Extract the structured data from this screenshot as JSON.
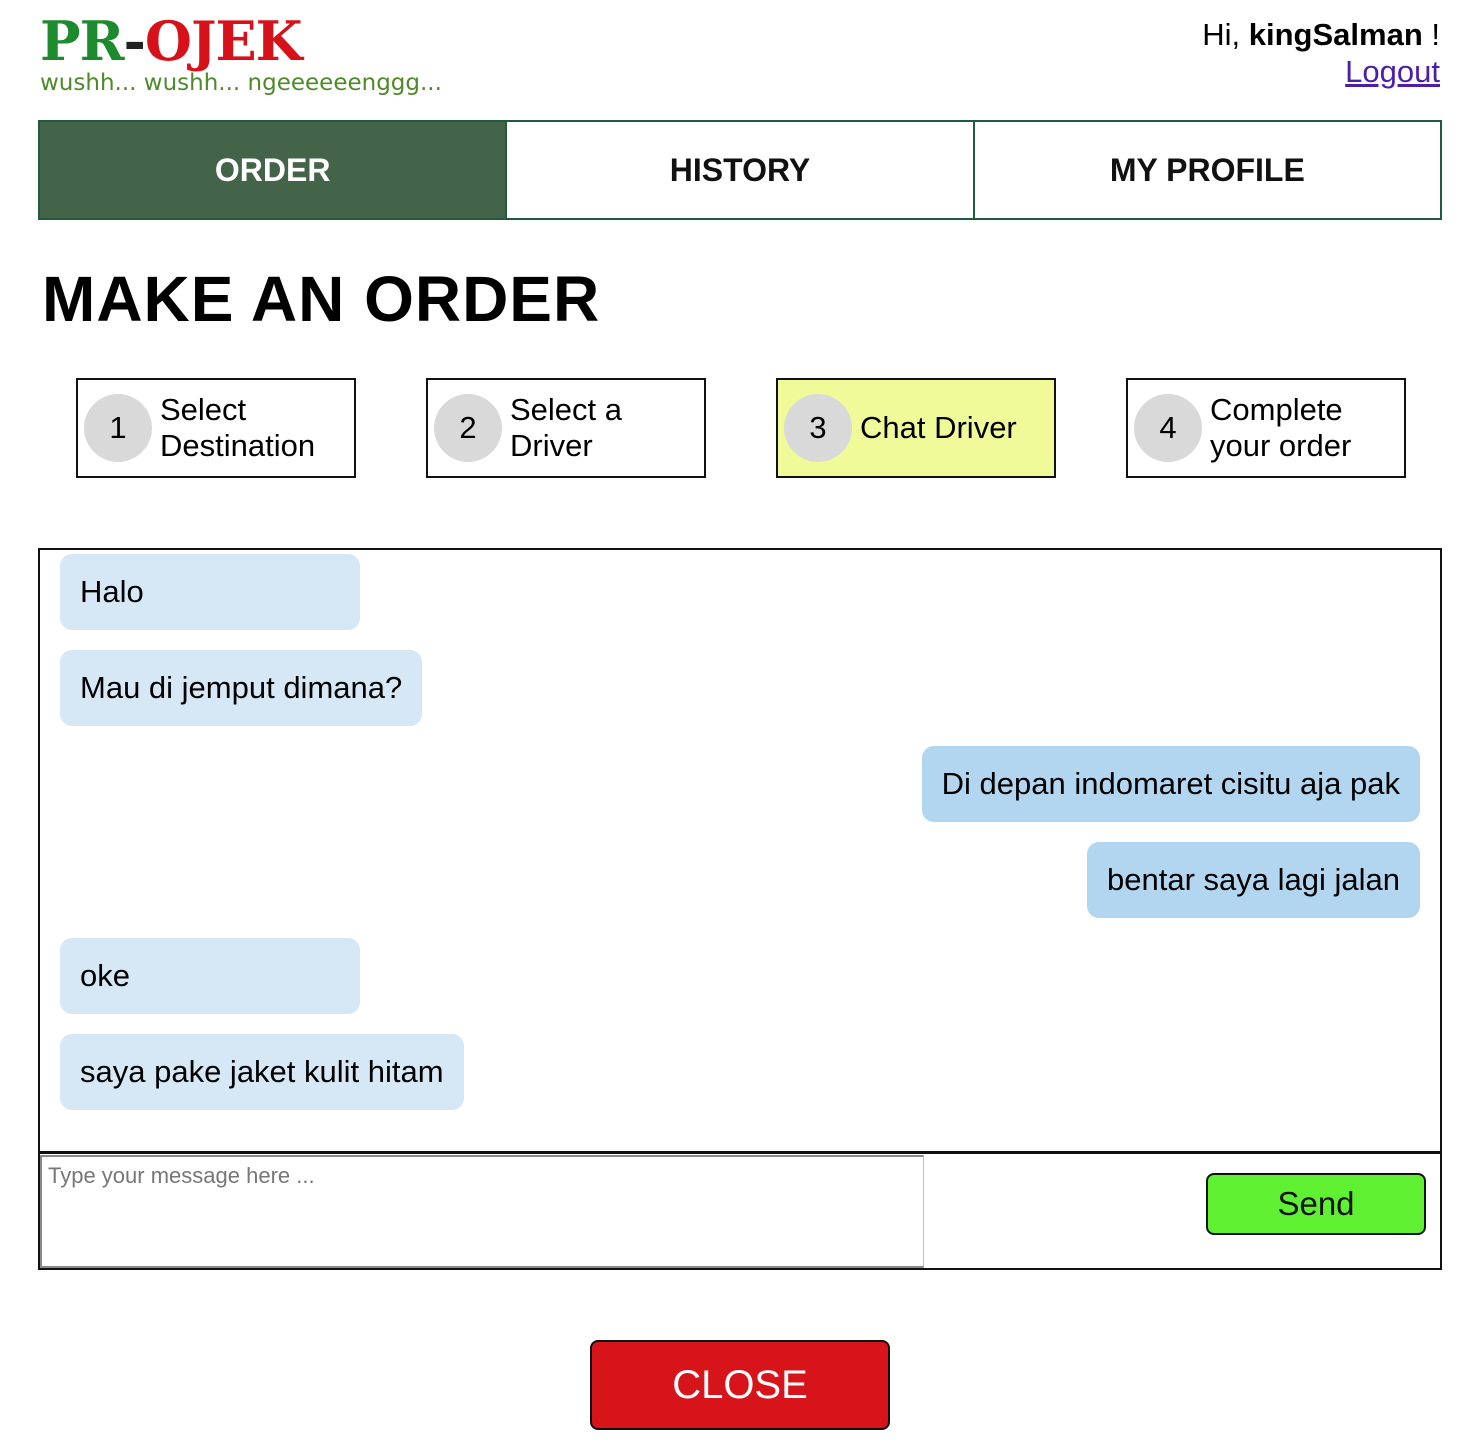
{
  "logo": {
    "pr": "PR",
    "dash": "-",
    "ojek": "OJEK",
    "tagline": "wushh... wushh... ngeeeeeenggg..."
  },
  "user": {
    "greeting_prefix": "Hi, ",
    "username": "kingSalman",
    "greeting_suffix": " !",
    "logout": "Logout"
  },
  "nav": {
    "tabs": [
      {
        "label": "ORDER",
        "active": true
      },
      {
        "label": "HISTORY",
        "active": false
      },
      {
        "label": "MY PROFILE",
        "active": false
      }
    ]
  },
  "page_title": "MAKE AN ORDER",
  "steps": [
    {
      "number": "1",
      "line1": "Select",
      "line2": "Destination",
      "active": false
    },
    {
      "number": "2",
      "line1": "Select a",
      "line2": "Driver",
      "active": false
    },
    {
      "number": "3",
      "line1": "Chat Driver",
      "line2": "",
      "active": true
    },
    {
      "number": "4",
      "line1": "Complete",
      "line2": "your order",
      "active": false
    }
  ],
  "chat": {
    "messages": [
      {
        "text": "Halo",
        "from": "driver"
      },
      {
        "text": "Mau di jemput dimana?",
        "from": "driver"
      },
      {
        "text": "Di depan indomaret cisitu aja pak",
        "from": "user"
      },
      {
        "text": "bentar saya lagi jalan",
        "from": "user"
      },
      {
        "text": "oke",
        "from": "driver"
      },
      {
        "text": "saya pake jaket kulit hitam",
        "from": "driver"
      }
    ],
    "input_placeholder": "Type your message here ...",
    "input_value": "",
    "send_label": "Send"
  },
  "close_label": "CLOSE",
  "colors": {
    "active_tab": "#436448",
    "active_step": "#f1fa98",
    "bubble_driver": "#d6e8f6",
    "bubble_user": "#b2d6ef",
    "send_button": "#5ff031",
    "close_button": "#d8141b"
  }
}
